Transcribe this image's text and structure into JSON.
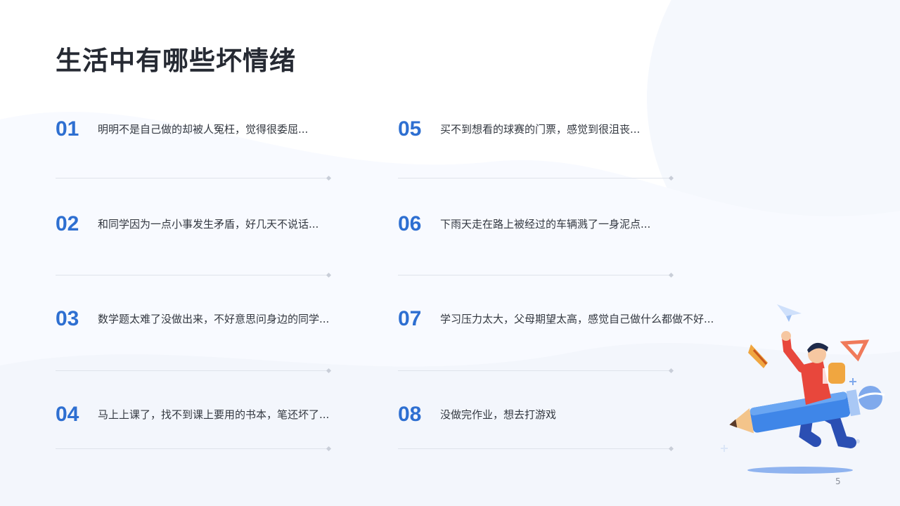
{
  "slide": {
    "title": "生活中有哪些坏情绪",
    "page_number": "5",
    "items": [
      {
        "num": "01",
        "text": "明明不是自己做的却被人冤枉，觉得很委屈..."
      },
      {
        "num": "02",
        "text": "和同学因为一点小事发生矛盾，好几天不说话..."
      },
      {
        "num": "03",
        "text": "数学题太难了没做出来，不好意思问身边的同学..."
      },
      {
        "num": "04",
        "text": "马上上课了，找不到课上要用的书本，笔还坏了..."
      },
      {
        "num": "05",
        "text": "买不到想看的球赛的门票，感觉到很沮丧..."
      },
      {
        "num": "06",
        "text": "下雨天走在路上被经过的车辆溅了一身泥点..."
      },
      {
        "num": "07",
        "text": "学习压力太大，父母期望太高，感觉自己做什么都做不好..."
      },
      {
        "num": "08",
        "text": "没做完作业，想去打游戏"
      }
    ],
    "colors": {
      "accent": "#2e6fd1",
      "title": "#262a33",
      "text": "#333840",
      "divider": "#dfe3ea"
    },
    "illustration": "student-riding-pencil-illustration"
  }
}
